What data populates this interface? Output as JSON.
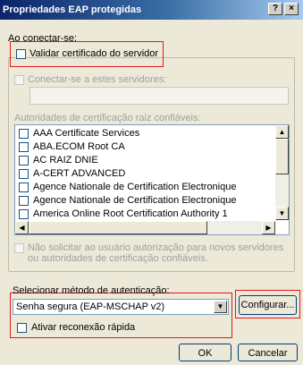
{
  "window": {
    "title": "Propriedades EAP protegidas",
    "help_button": "?",
    "close_button": "×"
  },
  "connect_label": "Ao conectar-se:",
  "validate_cert": {
    "label": "Validar certificado do servidor",
    "checked": false
  },
  "connect_servers": {
    "label": "Conectar-se a estes servidores:",
    "value": "",
    "checked": false
  },
  "root_ca_label": "Autoridades de certificação raiz confiáveis:",
  "root_ca_items": [
    {
      "label": "AAA Certificate Services",
      "checked": false
    },
    {
      "label": "ABA.ECOM Root CA",
      "checked": false
    },
    {
      "label": "AC RAIZ DNIE",
      "checked": false
    },
    {
      "label": "A-CERT ADVANCED",
      "checked": false
    },
    {
      "label": "Agence Nationale de Certification Electronique",
      "checked": false
    },
    {
      "label": "Agence Nationale de Certification Electronique",
      "checked": false
    },
    {
      "label": "America Online Root Certification Authority 1",
      "checked": false
    }
  ],
  "no_prompt": {
    "line1": "Não solicitar ao usuário autorização para novos servidores",
    "line2": "ou autoridades de certificação confiáveis."
  },
  "auth_method": {
    "label": "Selecionar método de autenticação:",
    "selected": "Senha segura (EAP-MSCHAP v2)",
    "configure_label": "Configurar..."
  },
  "fast_reconnect": {
    "label": "Ativar reconexão rápida",
    "checked": false
  },
  "buttons": {
    "ok": "OK",
    "cancel": "Cancelar"
  },
  "scroll_arrows": {
    "up": "▲",
    "down": "▼",
    "left": "◀",
    "right": "▶"
  },
  "accent_colors": {
    "highlight_box": "#e8151c",
    "title_start": "#0a246a"
  }
}
